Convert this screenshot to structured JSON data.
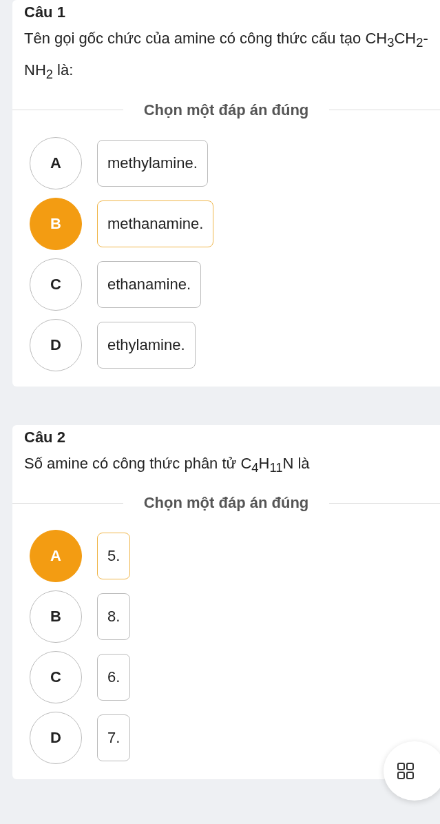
{
  "questions": [
    {
      "title": "Câu 1",
      "text": "Tên gọi gốc chức của amine có công thức cấu tạo CH$_{3}$CH$_{2}$-NH$_{2}$ là:",
      "prompt": "Chọn một đáp án đúng",
      "options": [
        {
          "letter": "A",
          "text": "methylamine.",
          "selected": false
        },
        {
          "letter": "B",
          "text": "methanamine.",
          "selected": true
        },
        {
          "letter": "C",
          "text": "ethanamine.",
          "selected": false
        },
        {
          "letter": "D",
          "text": "ethylamine.",
          "selected": false
        }
      ]
    },
    {
      "title": "Câu 2",
      "text": "Số amine có công thức phân tử C$_{4}$H$_{11}$N là",
      "prompt": "Chọn một đáp án đúng",
      "options": [
        {
          "letter": "A",
          "text": "5.",
          "selected": true
        },
        {
          "letter": "B",
          "text": "8.",
          "selected": false
        },
        {
          "letter": "C",
          "text": "6.",
          "selected": false
        },
        {
          "letter": "D",
          "text": "7.",
          "selected": false
        }
      ]
    }
  ]
}
